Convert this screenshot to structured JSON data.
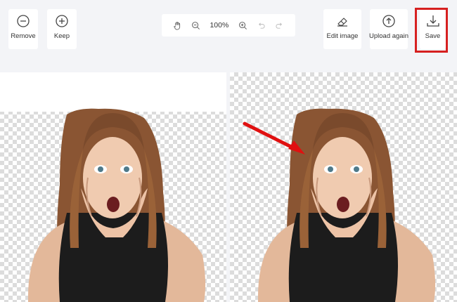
{
  "toolbar": {
    "remove_label": "Remove",
    "keep_label": "Keep",
    "edit_label": "Edit image",
    "upload_label": "Upload again",
    "save_label": "Save"
  },
  "zoom": {
    "value": "100%"
  },
  "icons": {
    "remove": "minus-circle-icon",
    "keep": "plus-circle-icon",
    "edit": "eraser-icon",
    "upload": "arrow-up-circle-icon",
    "save": "download-icon",
    "pan": "hand-icon",
    "zoom_out": "zoom-out-icon",
    "zoom_in": "zoom-in-icon",
    "undo": "undo-icon",
    "redo": "redo-icon"
  },
  "colors": {
    "highlight": "#d62020",
    "arrow": "#e01010",
    "background": "#f3f4f7",
    "hair": "#8a5533"
  }
}
